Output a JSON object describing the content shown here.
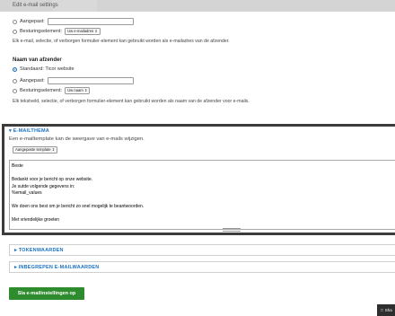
{
  "window": {
    "title": "Edit e-mail settings"
  },
  "sender_email": {
    "custom_label": "Aangepast:",
    "custom_value": "",
    "form_element_label": "Besturingselement:",
    "form_element_select": "Uw e-mailadres ⇕",
    "description": "Elk e-mail, selectie, of verborgen formulier-element kan gebruikt worden als e-mailadres van de afzender."
  },
  "sender_name": {
    "heading": "Naam van afzender",
    "standard_label": "Standaard: Ticor website",
    "custom_label": "Aangepast:",
    "custom_value": "",
    "form_element_label": "Besturingselement:",
    "form_element_select": "Uw naam ⇕",
    "description": "Elk tekstveld, selectie, of verborgen formulier-element kan gebruikt worden als naam van de afzender voor e-mails."
  },
  "email_theme": {
    "legend": "▾ E-MAILTHEMA",
    "description": "Een e-mailtemplate kan de weergave van e-mails wijzigen.",
    "template_select": "Aangepaste template ⇕",
    "body_lines": [
      "Beste",
      "",
      "Bedankt voor je bericht op onze website.",
      "Je sutde volgende gegevens in:",
      "%email_values",
      "",
      "We doen ons best om je bericht zo snel mogelijk te beantwoorden.",
      "",
      "Met vriendelijke groeten"
    ]
  },
  "token_values": {
    "label": "▸ TOKENWAARDEN"
  },
  "included_values": {
    "label": "▸ INBEGREPEN E-MAILWAARDEN"
  },
  "save_button": "Sla e-mailinstellingen op",
  "share_button": "Sha",
  "colors": {
    "accent": "#1b72c5",
    "save": "#2e8b2e",
    "frame": "#3c3c3c"
  }
}
